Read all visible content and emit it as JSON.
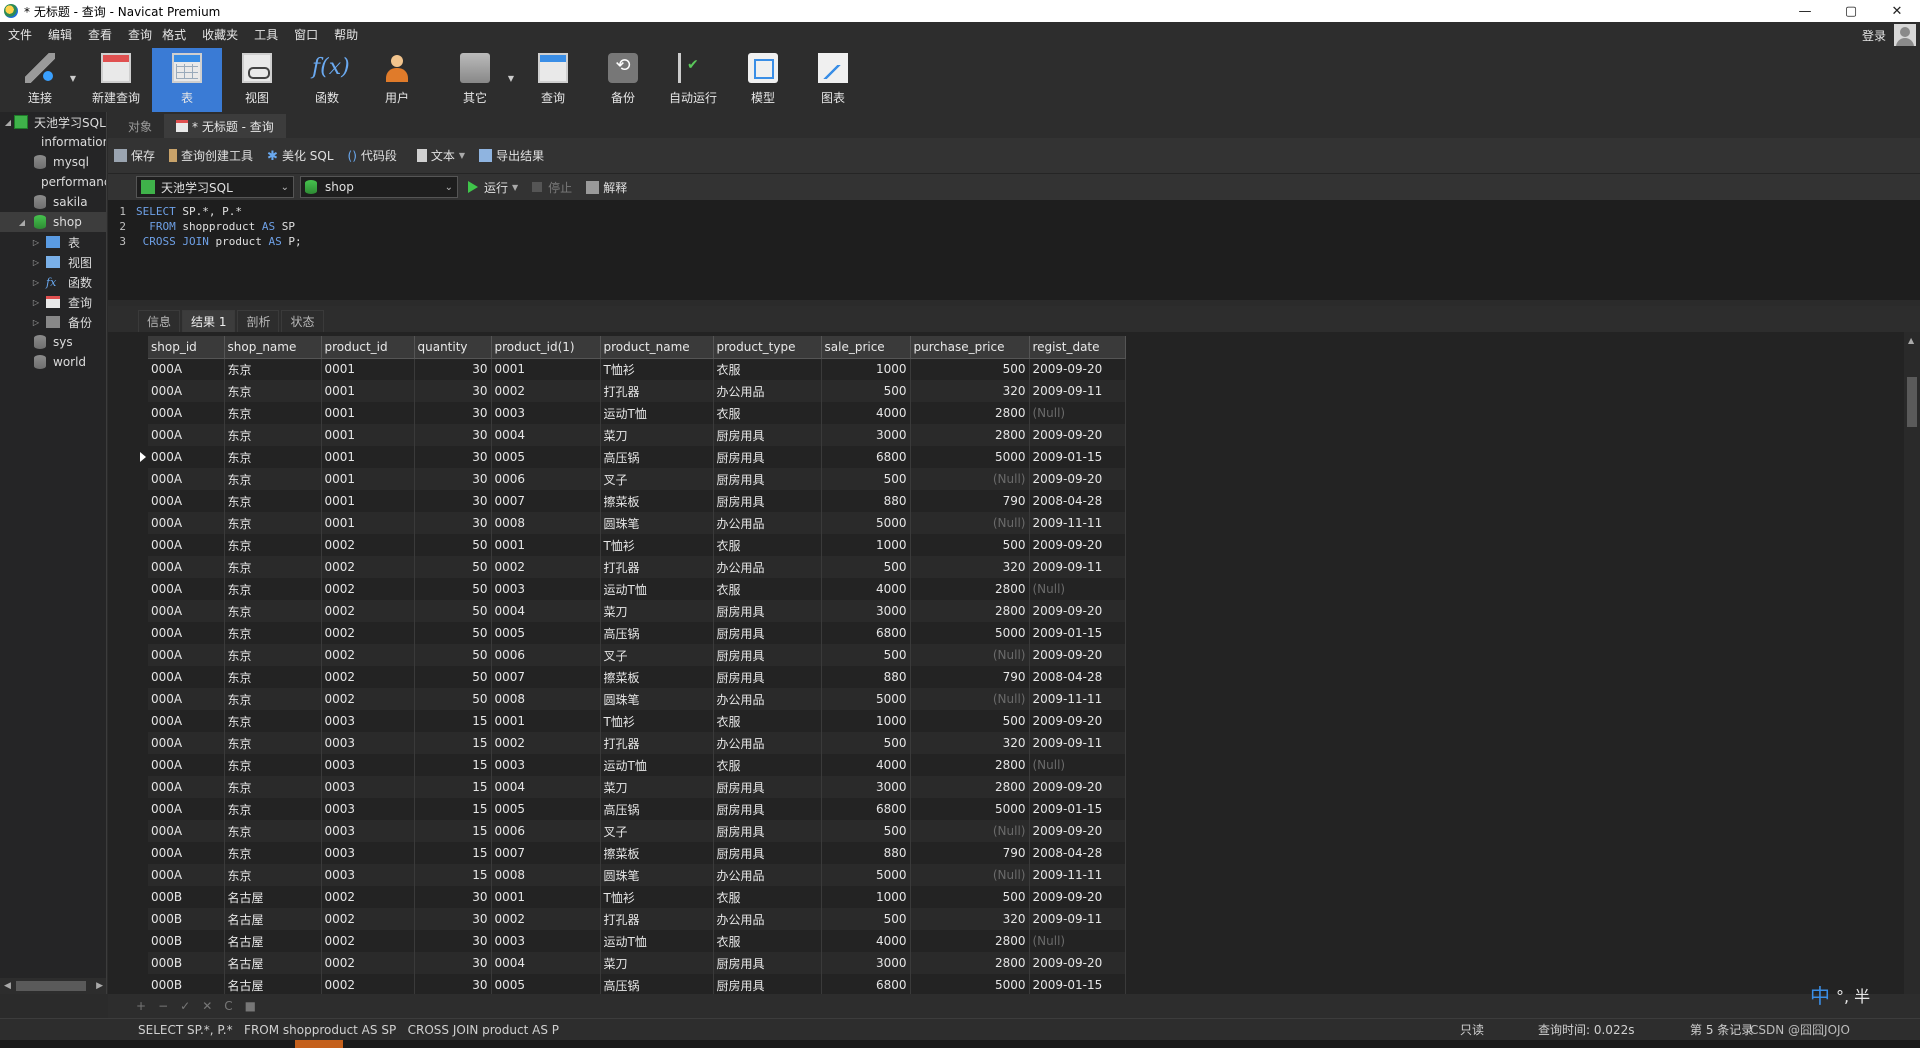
{
  "window": {
    "title": "* 无标题 - 查询 - Navicat Premium",
    "minimize": "—",
    "maximize": "▢",
    "close": "✕"
  },
  "menu": {
    "items": [
      "文件",
      "编辑",
      "查看",
      "查询",
      "格式",
      "收藏夹",
      "工具",
      "窗口",
      "帮助"
    ],
    "login": "登录"
  },
  "toolbar": {
    "buttons": [
      {
        "label": "连接",
        "icon": "connect-icon"
      },
      {
        "label": "新建查询",
        "icon": "new-query-icon"
      },
      {
        "label": "表",
        "icon": "table-icon"
      },
      {
        "label": "视图",
        "icon": "view-icon"
      },
      {
        "label": "函数",
        "icon": "function-icon",
        "glyph": "f(x)"
      },
      {
        "label": "用户",
        "icon": "user-icon"
      },
      {
        "label": "其它",
        "icon": "other-icon"
      },
      {
        "label": "查询",
        "icon": "query-icon"
      },
      {
        "label": "备份",
        "icon": "backup-icon"
      },
      {
        "label": "自动运行",
        "icon": "automation-icon"
      },
      {
        "label": "模型",
        "icon": "model-icon"
      },
      {
        "label": "图表",
        "icon": "chart-icon"
      }
    ],
    "active": "表",
    "accent": "#3a7bd5"
  },
  "navigator": {
    "connection": "天池学习SQL",
    "databases": [
      "information_s",
      "mysql",
      "performance",
      "sakila",
      "shop"
    ],
    "selected_db": "shop",
    "shop_children": [
      "表",
      "视图",
      "函数",
      "查询",
      "备份"
    ],
    "other_dbs": [
      "sys",
      "world"
    ]
  },
  "tabs": {
    "objects": "对象",
    "query": "* 无标题 - 查询"
  },
  "query_toolbar": {
    "save": "保存",
    "builder": "查询创建工具",
    "beautify": "美化 SQL",
    "snippet": "代码段",
    "text": "文本",
    "export": "导出结果",
    "connection": "天池学习SQL",
    "database": "shop",
    "run": "运行",
    "stop": "停止",
    "explain": "解释"
  },
  "editor": {
    "lines": [
      {
        "no": "1",
        "kw1": "SELECT",
        "rest1": " SP.*, P.*",
        "kw2": "",
        "rest2": ""
      },
      {
        "no": "2",
        "kw1": "  FROM",
        "rest1": " shopproduct ",
        "kw2": "AS",
        "rest2": " SP"
      },
      {
        "no": "3",
        "kw1": " CROSS JOIN",
        "rest1": " product ",
        "kw2": "AS",
        "rest2": " P;"
      }
    ]
  },
  "result_tabs": [
    "信息",
    "结果 1",
    "剖析",
    "状态"
  ],
  "active_result_tab": "结果 1",
  "grid": {
    "columns": [
      "shop_id",
      "shop_name",
      "product_id",
      "quantity",
      "product_id(1)",
      "product_name",
      "product_type",
      "sale_price",
      "purchase_price",
      "regist_date"
    ],
    "rows": [
      [
        "000A",
        "东京",
        "0001",
        "30",
        "0001",
        "T恤衫",
        "衣服",
        "1000",
        "500",
        "2009-09-20"
      ],
      [
        "000A",
        "东京",
        "0001",
        "30",
        "0002",
        "打孔器",
        "办公用品",
        "500",
        "320",
        "2009-09-11"
      ],
      [
        "000A",
        "东京",
        "0001",
        "30",
        "0003",
        "运动T恤",
        "衣服",
        "4000",
        "2800",
        "(Null)"
      ],
      [
        "000A",
        "东京",
        "0001",
        "30",
        "0004",
        "菜刀",
        "厨房用具",
        "3000",
        "2800",
        "2009-09-20"
      ],
      [
        "000A",
        "东京",
        "0001",
        "30",
        "0005",
        "高压锅",
        "厨房用具",
        "6800",
        "5000",
        "2009-01-15"
      ],
      [
        "000A",
        "东京",
        "0001",
        "30",
        "0006",
        "叉子",
        "厨房用具",
        "500",
        "(Null)",
        "2009-09-20"
      ],
      [
        "000A",
        "东京",
        "0001",
        "30",
        "0007",
        "擦菜板",
        "厨房用具",
        "880",
        "790",
        "2008-04-28"
      ],
      [
        "000A",
        "东京",
        "0001",
        "30",
        "0008",
        "圆珠笔",
        "办公用品",
        "5000",
        "(Null)",
        "2009-11-11"
      ],
      [
        "000A",
        "东京",
        "0002",
        "50",
        "0001",
        "T恤衫",
        "衣服",
        "1000",
        "500",
        "2009-09-20"
      ],
      [
        "000A",
        "东京",
        "0002",
        "50",
        "0002",
        "打孔器",
        "办公用品",
        "500",
        "320",
        "2009-09-11"
      ],
      [
        "000A",
        "东京",
        "0002",
        "50",
        "0003",
        "运动T恤",
        "衣服",
        "4000",
        "2800",
        "(Null)"
      ],
      [
        "000A",
        "东京",
        "0002",
        "50",
        "0004",
        "菜刀",
        "厨房用具",
        "3000",
        "2800",
        "2009-09-20"
      ],
      [
        "000A",
        "东京",
        "0002",
        "50",
        "0005",
        "高压锅",
        "厨房用具",
        "6800",
        "5000",
        "2009-01-15"
      ],
      [
        "000A",
        "东京",
        "0002",
        "50",
        "0006",
        "叉子",
        "厨房用具",
        "500",
        "(Null)",
        "2009-09-20"
      ],
      [
        "000A",
        "东京",
        "0002",
        "50",
        "0007",
        "擦菜板",
        "厨房用具",
        "880",
        "790",
        "2008-04-28"
      ],
      [
        "000A",
        "东京",
        "0002",
        "50",
        "0008",
        "圆珠笔",
        "办公用品",
        "5000",
        "(Null)",
        "2009-11-11"
      ],
      [
        "000A",
        "东京",
        "0003",
        "15",
        "0001",
        "T恤衫",
        "衣服",
        "1000",
        "500",
        "2009-09-20"
      ],
      [
        "000A",
        "东京",
        "0003",
        "15",
        "0002",
        "打孔器",
        "办公用品",
        "500",
        "320",
        "2009-09-11"
      ],
      [
        "000A",
        "东京",
        "0003",
        "15",
        "0003",
        "运动T恤",
        "衣服",
        "4000",
        "2800",
        "(Null)"
      ],
      [
        "000A",
        "东京",
        "0003",
        "15",
        "0004",
        "菜刀",
        "厨房用具",
        "3000",
        "2800",
        "2009-09-20"
      ],
      [
        "000A",
        "东京",
        "0003",
        "15",
        "0005",
        "高压锅",
        "厨房用具",
        "6800",
        "5000",
        "2009-01-15"
      ],
      [
        "000A",
        "东京",
        "0003",
        "15",
        "0006",
        "叉子",
        "厨房用具",
        "500",
        "(Null)",
        "2009-09-20"
      ],
      [
        "000A",
        "东京",
        "0003",
        "15",
        "0007",
        "擦菜板",
        "厨房用具",
        "880",
        "790",
        "2008-04-28"
      ],
      [
        "000A",
        "东京",
        "0003",
        "15",
        "0008",
        "圆珠笔",
        "办公用品",
        "5000",
        "(Null)",
        "2009-11-11"
      ],
      [
        "000B",
        "名古屋",
        "0002",
        "30",
        "0001",
        "T恤衫",
        "衣服",
        "1000",
        "500",
        "2009-09-20"
      ],
      [
        "000B",
        "名古屋",
        "0002",
        "30",
        "0002",
        "打孔器",
        "办公用品",
        "500",
        "320",
        "2009-09-11"
      ],
      [
        "000B",
        "名古屋",
        "0002",
        "30",
        "0003",
        "运动T恤",
        "衣服",
        "4000",
        "2800",
        "(Null)"
      ],
      [
        "000B",
        "名古屋",
        "0002",
        "30",
        "0004",
        "菜刀",
        "厨房用具",
        "3000",
        "2800",
        "2009-09-20"
      ],
      [
        "000B",
        "名古屋",
        "0002",
        "30",
        "0005",
        "高压锅",
        "厨房用具",
        "6800",
        "5000",
        "2009-01-15"
      ]
    ],
    "current_row_index": 4
  },
  "grid_bar": [
    "+",
    "−",
    "✓",
    "✕",
    "C",
    "■"
  ],
  "status": {
    "sql": "SELECT SP.*, P.*   FROM shopproduct AS SP   CROSS JOIN product AS P",
    "readonly": "只读",
    "query_time": "查询时间: 0.022s",
    "records": "第 5 条记录",
    "watermark": "CSDN @囧囧JOJO"
  },
  "ime": {
    "zh": "中",
    "rest": "°, 半"
  }
}
